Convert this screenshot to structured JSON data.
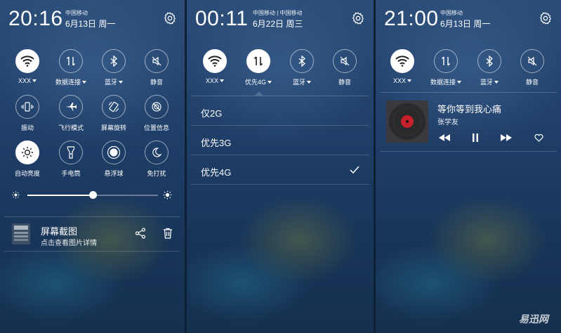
{
  "panel1": {
    "time": "20:16",
    "carrier": "中国移动",
    "date": "6月13日 周一",
    "toggles": [
      {
        "label": "XXX",
        "icon": "wifi-icon",
        "on": true,
        "dropdown": true
      },
      {
        "label": "数据连接",
        "icon": "data-connection-icon",
        "on": false,
        "dropdown": true
      },
      {
        "label": "蓝牙",
        "icon": "bluetooth-icon",
        "on": false,
        "dropdown": true
      },
      {
        "label": "静音",
        "icon": "mute-icon",
        "on": false,
        "dropdown": false
      },
      {
        "label": "振动",
        "icon": "vibrate-icon",
        "on": false,
        "dropdown": false
      },
      {
        "label": "飞行模式",
        "icon": "airplane-icon",
        "on": false,
        "dropdown": false
      },
      {
        "label": "屏幕旋转",
        "icon": "rotate-icon",
        "on": false,
        "dropdown": false
      },
      {
        "label": "位置信息",
        "icon": "location-icon",
        "on": false,
        "dropdown": false
      },
      {
        "label": "自动亮度",
        "icon": "brightness-icon",
        "on": true,
        "dropdown": false
      },
      {
        "label": "手电筒",
        "icon": "flashlight-icon",
        "on": false,
        "dropdown": false
      },
      {
        "label": "悬浮球",
        "icon": "float-ball-icon",
        "on": false,
        "dropdown": false
      },
      {
        "label": "免打扰",
        "icon": "moon-icon",
        "on": false,
        "dropdown": false
      }
    ],
    "brightness_level": 0.5,
    "notification": {
      "title": "屏幕截图",
      "subtitle": "点击查看图片详情"
    }
  },
  "panel2": {
    "time": "00:11",
    "carrier": "中国移动 | 中国移动",
    "date": "6月22日 周三",
    "toggles": [
      {
        "label": "XXX",
        "icon": "wifi-icon",
        "on": true,
        "dropdown": true
      },
      {
        "label": "优先4G",
        "icon": "data-connection-icon",
        "on": true,
        "dropdown": true
      },
      {
        "label": "蓝牙",
        "icon": "bluetooth-icon",
        "on": false,
        "dropdown": true
      },
      {
        "label": "静音",
        "icon": "mute-icon",
        "on": false,
        "dropdown": false
      }
    ],
    "network_options": [
      {
        "label": "仅2G",
        "selected": false
      },
      {
        "label": "优先3G",
        "selected": false
      },
      {
        "label": "优先4G",
        "selected": true
      }
    ]
  },
  "panel3": {
    "time": "21:00",
    "carrier": "中国移动",
    "date": "6月13日 周一",
    "toggles": [
      {
        "label": "XXX",
        "icon": "wifi-icon",
        "on": true,
        "dropdown": true
      },
      {
        "label": "数据连接",
        "icon": "data-connection-icon",
        "on": false,
        "dropdown": true
      },
      {
        "label": "蓝牙",
        "icon": "bluetooth-icon",
        "on": false,
        "dropdown": true
      },
      {
        "label": "静音",
        "icon": "mute-icon",
        "on": false,
        "dropdown": false
      }
    ],
    "music": {
      "song": "等你等到我心痛",
      "artist": "张学友"
    }
  },
  "watermark": "易迅网",
  "colors": {
    "accent_red": "#c8202a",
    "panel_blue": "#1e3d66"
  }
}
